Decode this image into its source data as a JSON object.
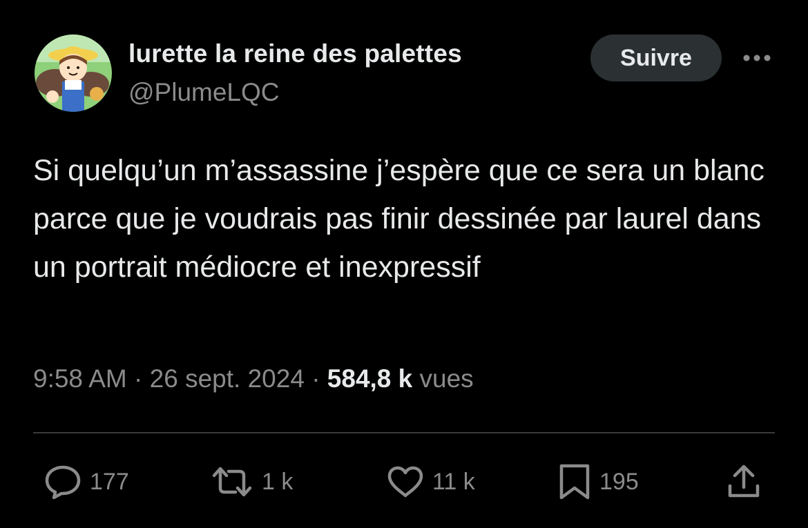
{
  "author": {
    "display_name": "lurette la reine des palettes",
    "handle": "@PlumeLQC",
    "avatar_icon": "avatar-cartoon-girl-icon"
  },
  "follow_label": "Suivre",
  "more_icon": "more-horizontal-icon",
  "tweet": {
    "text": "Si quelqu’un m’assassine j’espère que ce sera un blanc parce que je voudrais pas finir dessinée par laurel dans un portrait médiocre et inexpressif",
    "time": "9:58 AM",
    "separator": "·",
    "date": "26 sept. 2024",
    "views_count": "584,8 k",
    "views_label": "vues"
  },
  "actions": {
    "reply": {
      "icon": "reply-icon",
      "count": "177"
    },
    "retweet": {
      "icon": "retweet-icon",
      "count": "1 k"
    },
    "like": {
      "icon": "heart-icon",
      "count": "11 k"
    },
    "bookmark": {
      "icon": "bookmark-icon",
      "count": "195"
    },
    "share": {
      "icon": "share-icon"
    }
  },
  "colors": {
    "background": "#000000",
    "primary_text": "#e7e9ea",
    "secondary_text": "#8b8b8b",
    "follow_button_bg": "#2b3133"
  }
}
